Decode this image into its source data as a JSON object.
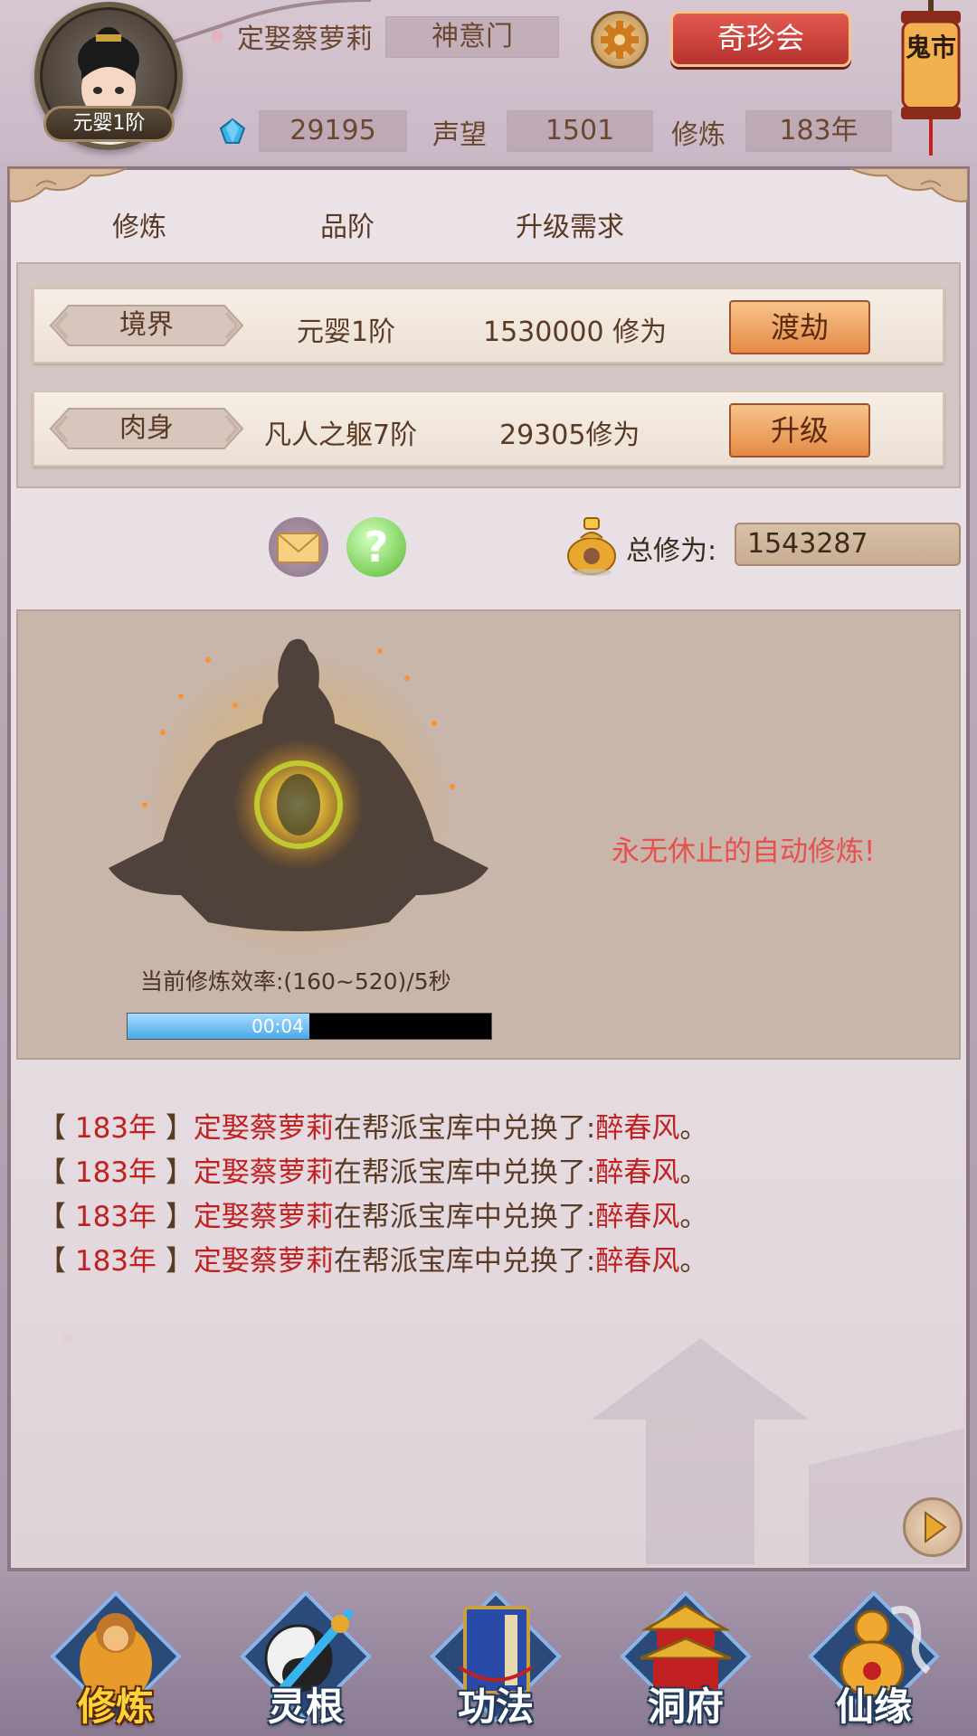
{
  "header": {
    "avatar_realm": "元婴1阶",
    "player_name": "定娶蔡萝莉",
    "sect": "神意门",
    "treasure_button": "奇珍会",
    "ghost_market": "鬼市",
    "spirit_stones": "29195",
    "reputation_label": "声望",
    "reputation": "1501",
    "cultivation_label": "修炼",
    "cultivation_years": "183年"
  },
  "table": {
    "headers": [
      "修炼",
      "品阶",
      "升级需求"
    ],
    "rows": [
      {
        "tag": "境界",
        "grade": "元婴1阶",
        "requirement": "1530000 修为",
        "button": "渡劫"
      },
      {
        "tag": "肉身",
        "grade": "凡人之躯7阶",
        "requirement": "29305修为",
        "button": "升级"
      }
    ]
  },
  "total": {
    "label": "总修为:",
    "value": "1543287"
  },
  "cultivate": {
    "auto_message": "永无休止的自动修炼!",
    "rate": "当前修炼效率:(160~520)/5秒",
    "timer": "00:04",
    "progress_fraction": 0.5
  },
  "log": [
    {
      "lb": "【",
      "year": " 183年 ",
      "rb": "】",
      "name": "定娶蔡萝莉",
      "mid": "在帮派宝库中兑换了:",
      "item": "醉春风",
      "end": "。"
    },
    {
      "lb": "【",
      "year": " 183年 ",
      "rb": "】",
      "name": "定娶蔡萝莉",
      "mid": "在帮派宝库中兑换了:",
      "item": "醉春风",
      "end": "。"
    },
    {
      "lb": "【",
      "year": " 183年 ",
      "rb": "】",
      "name": "定娶蔡萝莉",
      "mid": "在帮派宝库中兑换了:",
      "item": "醉春风",
      "end": "。"
    },
    {
      "lb": "【",
      "year": " 183年 ",
      "rb": "】",
      "name": "定娶蔡萝莉",
      "mid": "在帮派宝库中兑换了:",
      "item": "醉春风",
      "end": "。"
    }
  ],
  "nav": [
    {
      "label": "修炼",
      "icon": "meditating-monk-icon",
      "active": true
    },
    {
      "label": "灵根",
      "icon": "yin-yang-sword-icon",
      "active": false
    },
    {
      "label": "功法",
      "icon": "scripture-book-icon",
      "active": false
    },
    {
      "label": "洞府",
      "icon": "pagoda-icon",
      "active": false
    },
    {
      "label": "仙缘",
      "icon": "gourd-icon",
      "active": false
    }
  ],
  "colors": {
    "accent_red": "#c02020",
    "auto_message": "#e85050",
    "button_orange": "#e58a45"
  }
}
